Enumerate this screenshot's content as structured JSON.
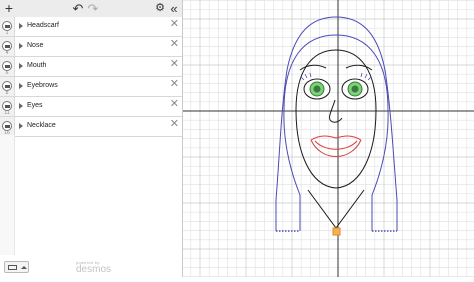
{
  "toolbar": {
    "add_label": "+",
    "undo_label": "↶",
    "redo_label": "↷",
    "settings_label": "⚙",
    "collapse_label": "«",
    "icons": [
      "add-icon",
      "undo-icon",
      "redo-icon",
      "gear-icon",
      "collapse-icon"
    ]
  },
  "folders": [
    {
      "label": "Headscarf",
      "index": "1"
    },
    {
      "label": "Nose",
      "index": "4"
    },
    {
      "label": "Mouth",
      "index": "6"
    },
    {
      "label": "Eyebrows",
      "index": "8"
    },
    {
      "label": "Eyes",
      "index": "11"
    },
    {
      "label": "Necklace",
      "index": "16"
    }
  ],
  "delete_glyph": "✕",
  "footer": {
    "powered": "powered by",
    "brand": "desmos"
  },
  "colors": {
    "grid_minor": "#e3e3e3",
    "grid_major": "#c8c8c8",
    "axis": "#333333",
    "headscarf": "#4b4bb4",
    "face": "#1a1a1a",
    "eye_iris": "#4aa04a",
    "mouth": "#d94040",
    "necklace": "#e08a20"
  }
}
